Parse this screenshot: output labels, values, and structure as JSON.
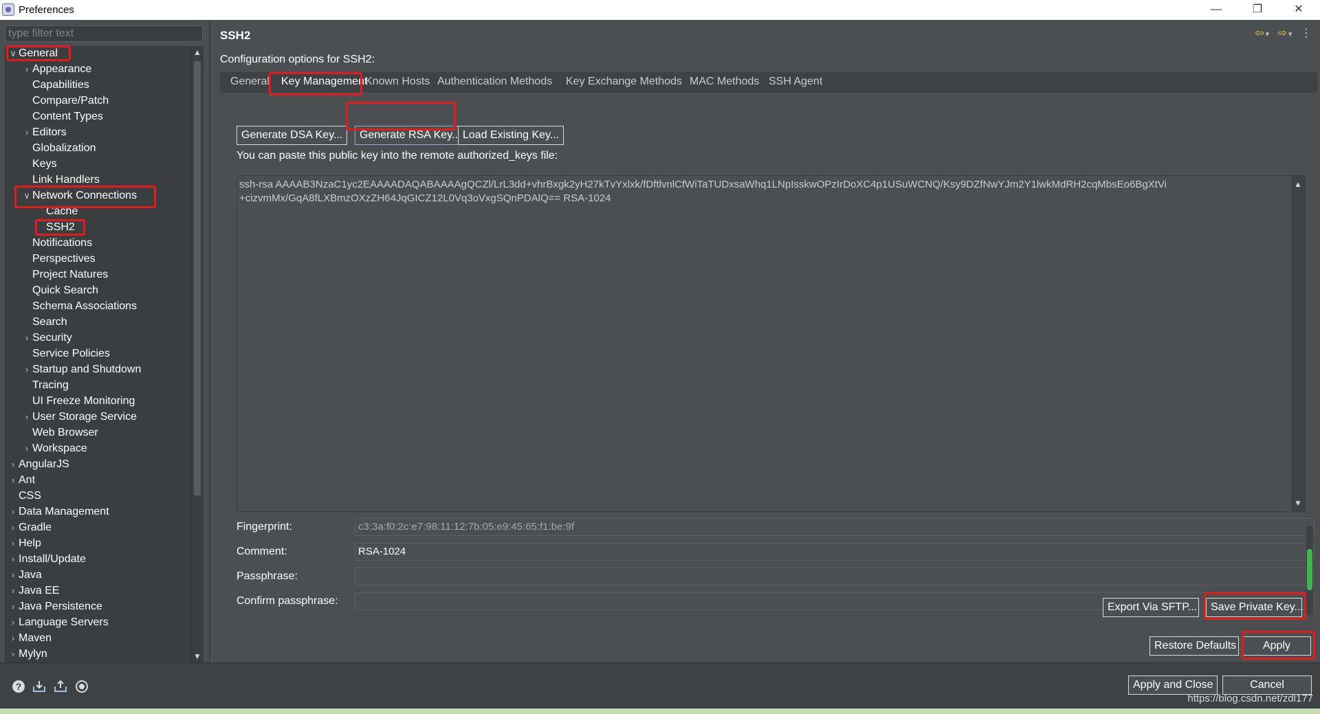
{
  "window": {
    "title": "Preferences",
    "controls": {
      "minimize": "—",
      "restore": "❐",
      "close": "✕"
    }
  },
  "filter": {
    "placeholder": "type filter text"
  },
  "tree": [
    {
      "label": "General",
      "chevron": "∨",
      "level": 0
    },
    {
      "label": "Appearance",
      "chevron": "›",
      "level": 1
    },
    {
      "label": "Capabilities",
      "chevron": "",
      "level": 1
    },
    {
      "label": "Compare/Patch",
      "chevron": "",
      "level": 1
    },
    {
      "label": "Content Types",
      "chevron": "",
      "level": 1
    },
    {
      "label": "Editors",
      "chevron": "›",
      "level": 1
    },
    {
      "label": "Globalization",
      "chevron": "",
      "level": 1
    },
    {
      "label": "Keys",
      "chevron": "",
      "level": 1
    },
    {
      "label": "Link Handlers",
      "chevron": "",
      "level": 1
    },
    {
      "label": "Network Connections",
      "chevron": "∨",
      "level": 1
    },
    {
      "label": "Cache",
      "chevron": "",
      "level": 2
    },
    {
      "label": "SSH2",
      "chevron": "",
      "level": 2
    },
    {
      "label": "Notifications",
      "chevron": "",
      "level": 1
    },
    {
      "label": "Perspectives",
      "chevron": "",
      "level": 1
    },
    {
      "label": "Project Natures",
      "chevron": "",
      "level": 1
    },
    {
      "label": "Quick Search",
      "chevron": "",
      "level": 1
    },
    {
      "label": "Schema Associations",
      "chevron": "",
      "level": 1
    },
    {
      "label": "Search",
      "chevron": "",
      "level": 1
    },
    {
      "label": "Security",
      "chevron": "›",
      "level": 1
    },
    {
      "label": "Service Policies",
      "chevron": "",
      "level": 1
    },
    {
      "label": "Startup and Shutdown",
      "chevron": "›",
      "level": 1
    },
    {
      "label": "Tracing",
      "chevron": "",
      "level": 1
    },
    {
      "label": "UI Freeze Monitoring",
      "chevron": "",
      "level": 1
    },
    {
      "label": "User Storage Service",
      "chevron": "›",
      "level": 1
    },
    {
      "label": "Web Browser",
      "chevron": "",
      "level": 1
    },
    {
      "label": "Workspace",
      "chevron": "›",
      "level": 1
    },
    {
      "label": "AngularJS",
      "chevron": "›",
      "level": 0
    },
    {
      "label": "Ant",
      "chevron": "›",
      "level": 0
    },
    {
      "label": "CSS",
      "chevron": "",
      "level": 0
    },
    {
      "label": "Data Management",
      "chevron": "›",
      "level": 0
    },
    {
      "label": "Gradle",
      "chevron": "›",
      "level": 0
    },
    {
      "label": "Help",
      "chevron": "›",
      "level": 0
    },
    {
      "label": "Install/Update",
      "chevron": "›",
      "level": 0
    },
    {
      "label": "Java",
      "chevron": "›",
      "level": 0
    },
    {
      "label": "Java EE",
      "chevron": "›",
      "level": 0
    },
    {
      "label": "Java Persistence",
      "chevron": "›",
      "level": 0
    },
    {
      "label": "Language Servers",
      "chevron": "›",
      "level": 0
    },
    {
      "label": "Maven",
      "chevron": "›",
      "level": 0
    },
    {
      "label": "Mylyn",
      "chevron": "›",
      "level": 0
    }
  ],
  "page": {
    "title": "SSH2",
    "subtitle": "Configuration options for SSH2:",
    "nav": {
      "back": "⇦",
      "back_menu": "▾",
      "forward": "⇨",
      "forward_menu": "▾",
      "more": "⋮"
    }
  },
  "tabs": [
    "General",
    "Key Management",
    "Known Hosts",
    "Authentication Methods",
    "Key Exchange Methods",
    "MAC Methods",
    "SSH Agent"
  ],
  "buttons": {
    "gen_dsa": "Generate DSA Key...",
    "gen_rsa": "Generate RSA Key...",
    "load_existing": "Load Existing Key...",
    "export_sftp": "Export Via SFTP...",
    "save_private": "Save Private Key...",
    "restore_defaults": "Restore Defaults",
    "apply": "Apply",
    "apply_close": "Apply and Close",
    "cancel": "Cancel"
  },
  "key": {
    "paste_label": "You can paste this public key into the remote authorized_keys file:",
    "line1": "ssh-rsa AAAAB3NzaC1yc2EAAAADAQABAAAAgQCZl/LrL3dd+vhrBxgk2yH27kTvYxlxk/fDftlvnlCfWiTaTUDxsaWhq1LNpIsskwOPzIrDoXC4p1USuWCNQ/Ksy9DZfNwYJm2Y1lwkMdRH2cqMbsEo6BgXtVi",
    "line2": "+cizvmMx/GqA8fLXBmzOXzZH64JqGICZ12L0Vq3oVxgSQnPDAlQ== RSA-1024"
  },
  "fields": {
    "fingerprint_label": "Fingerprint:",
    "fingerprint_value": "c3:3a:f0:2c:e7:98:11:12:7b:05:e9:45:65:f1:be:9f",
    "comment_label": "Comment:",
    "comment_value": "RSA-1024",
    "passphrase_label": "Passphrase:",
    "passphrase_value": "",
    "confirm_label": "Confirm passphrase:",
    "confirm_value": ""
  },
  "watermark": "https://blog.csdn.net/zdl177",
  "colors": {
    "highlight": "#e31b1b",
    "background": "#4b4f52",
    "tree_bg": "#3b3e41"
  }
}
